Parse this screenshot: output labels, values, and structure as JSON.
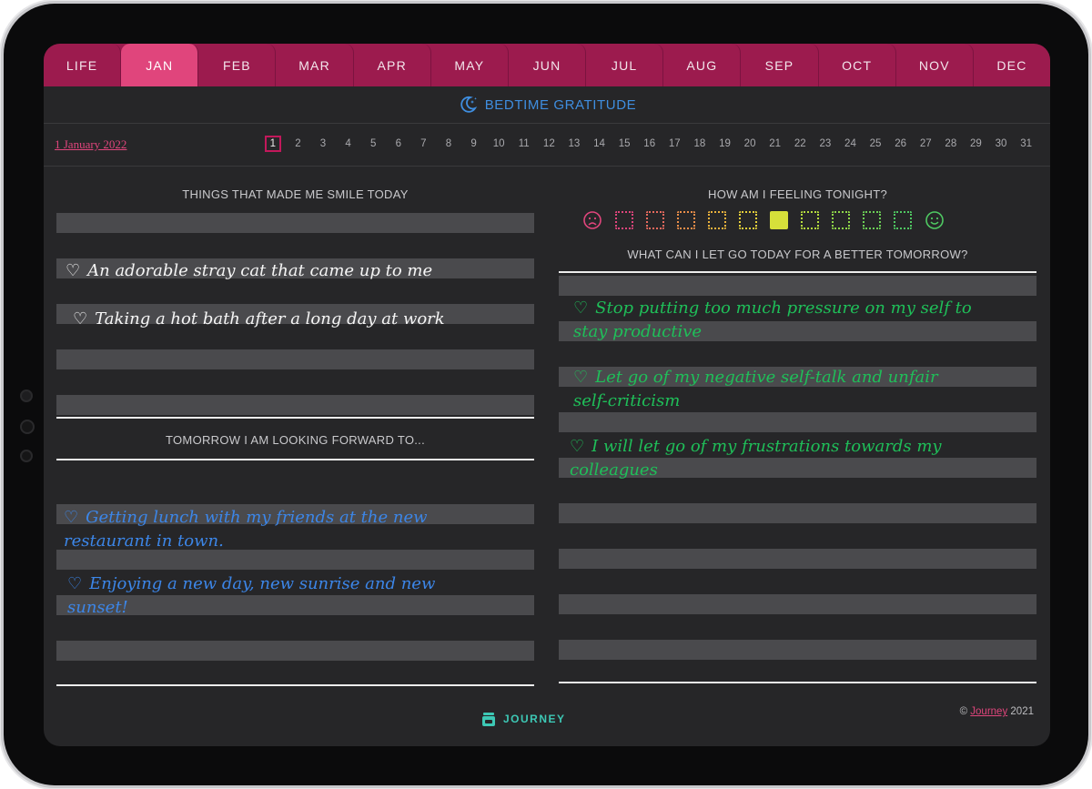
{
  "months": [
    "LIFE",
    "JAN",
    "FEB",
    "MAR",
    "APR",
    "MAY",
    "JUN",
    "JUL",
    "AUG",
    "SEP",
    "OCT",
    "NOV",
    "DEC"
  ],
  "active_month": "JAN",
  "header": {
    "title": "BEDTIME GRATITUDE",
    "icon": "moon-stars-icon"
  },
  "date_link": "1 January 2022",
  "days": [
    "1",
    "2",
    "3",
    "4",
    "5",
    "6",
    "7",
    "8",
    "9",
    "10",
    "11",
    "12",
    "13",
    "14",
    "15",
    "16",
    "17",
    "18",
    "19",
    "20",
    "21",
    "22",
    "23",
    "24",
    "25",
    "26",
    "27",
    "28",
    "29",
    "30",
    "31"
  ],
  "active_day": "1",
  "smile": {
    "heading": "THINGS THAT MADE ME SMILE TODAY",
    "entries": [
      "An adorable stray cat that came up to me",
      "Taking a hot bath after a long day at work"
    ]
  },
  "forward": {
    "heading": "TOMORROW I AM LOOKING FORWARD TO...",
    "entries": [
      "Getting lunch with my friends at the new\nrestaurant in town.",
      "Enjoying a new day, new sunrise and new\nsunset!"
    ]
  },
  "feeling": {
    "heading": "HOW AM I FEELING TONIGHT?",
    "selected_index": 5,
    "scale_colors": [
      "#e0457c",
      "#e86a5e",
      "#eb8e49",
      "#eab23c",
      "#e6d03a",
      "#d6e03a",
      "#b6de3e",
      "#8fd649",
      "#6ccf56",
      "#4fc862"
    ],
    "sad_icon": "sad-face-icon",
    "happy_icon": "happy-face-icon"
  },
  "letgo": {
    "heading": "WHAT CAN I LET GO TODAY FOR A BETTER TOMORROW?",
    "entries": [
      "Stop putting too much pressure on my self to\nstay productive",
      "Let go of my negative self-talk and unfair\nself-criticism",
      "I will let go of my frustrations towards my\ncolleagues"
    ]
  },
  "footer": {
    "logo_text": "JOURNEY",
    "copyright_prefix": "©",
    "copyright_link": "Journey",
    "copyright_year": "2021"
  },
  "colors": {
    "tab_bg": "#9c1b4e",
    "tab_active": "#e0457c",
    "screen_bg": "#262628",
    "title_blue": "#3f8ee0",
    "ink_white": "#f5f5f5",
    "ink_blue": "#3c86e8",
    "ink_green": "#1fbf59"
  }
}
